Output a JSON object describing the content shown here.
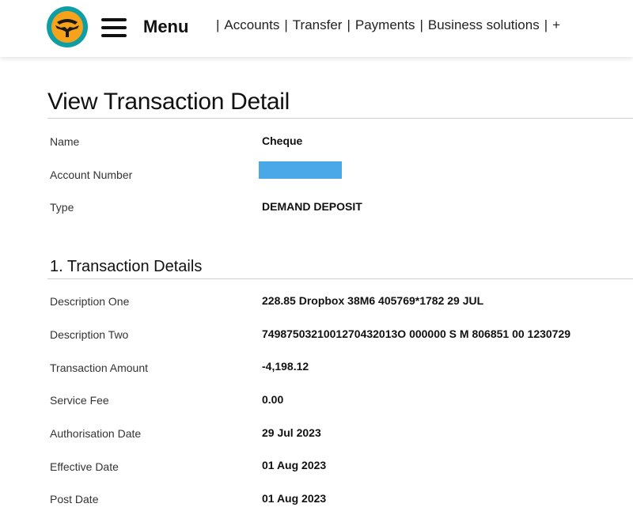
{
  "header": {
    "menu_label": "Menu",
    "nav": [
      "Accounts",
      "Transfer",
      "Payments",
      "Business solutions",
      "+"
    ],
    "logo_colors": {
      "ring": "#0f9ea4",
      "fill": "#f7a21b",
      "tree": "#1a1a1a"
    }
  },
  "page": {
    "title": "View Transaction Detail"
  },
  "account": {
    "name_label": "Name",
    "name_value": "Cheque",
    "number_label": "Account Number",
    "type_label": "Type",
    "type_value": "DEMAND DEPOSIT",
    "redaction_color": "#4aa8e8"
  },
  "section": {
    "title": "1. Transaction Details",
    "rows": [
      {
        "label": "Description One",
        "value": "228.85 Dropbox 38M6 405769*1782 29 JUL"
      },
      {
        "label": "Description Two",
        "value": "7498750321001270432013O 000000 S M 806851 00 1230729"
      },
      {
        "label": "Transaction Amount",
        "value": "-4,198.12"
      },
      {
        "label": "Service Fee",
        "value": "0.00"
      },
      {
        "label": "Authorisation Date",
        "value": "29 Jul 2023"
      },
      {
        "label": "Effective Date",
        "value": "01 Aug 2023"
      },
      {
        "label": "Post Date",
        "value": "01 Aug 2023"
      }
    ]
  }
}
